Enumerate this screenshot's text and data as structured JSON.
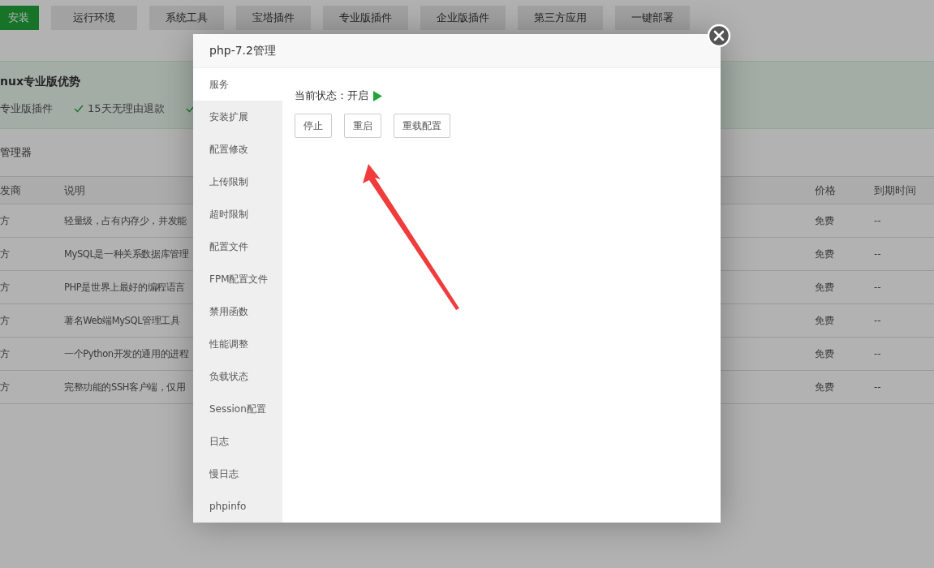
{
  "top_tabs": [
    {
      "label": "安装",
      "selected": true
    },
    {
      "label": "运行环境",
      "selected": false
    },
    {
      "label": "系统工具",
      "selected": false
    },
    {
      "label": "宝塔插件",
      "selected": false
    },
    {
      "label": "专业版插件",
      "selected": false
    },
    {
      "label": "企业版插件",
      "selected": false
    },
    {
      "label": "第三方应用",
      "selected": false
    },
    {
      "label": "一键部署",
      "selected": false
    }
  ],
  "promo": {
    "title": "nux专业版优势",
    "features": [
      {
        "text": "专业版插件",
        "checked": false
      },
      {
        "text": "15天无理由退款",
        "checked": true
      }
    ]
  },
  "section_title": "管理器",
  "table": {
    "columns": [
      "发商",
      "说明",
      "价格",
      "到期时间"
    ],
    "rows": [
      {
        "vendor": "方",
        "description": "轻量级，占有内存少，并发能",
        "price": "免费",
        "expiry": "--"
      },
      {
        "vendor": "方",
        "description": "MySQL是一种关系数据库管理",
        "price": "免费",
        "expiry": "--"
      },
      {
        "vendor": "方",
        "description": "PHP是世界上最好的编程语言",
        "price": "免费",
        "expiry": "--"
      },
      {
        "vendor": "方",
        "description": "著名Web端MySQL管理工具",
        "price": "免费",
        "expiry": "--"
      },
      {
        "vendor": "方",
        "description": "一个Python开发的通用的进程",
        "price": "免费",
        "expiry": "--"
      },
      {
        "vendor": "方",
        "description": "完整功能的SSH客户端，仅用",
        "price": "免费",
        "expiry": "--"
      }
    ]
  },
  "dialog": {
    "title": "php-7.2管理",
    "nav": [
      {
        "label": "服务",
        "selected": true
      },
      {
        "label": "安装扩展",
        "selected": false
      },
      {
        "label": "配置修改",
        "selected": false
      },
      {
        "label": "上传限制",
        "selected": false
      },
      {
        "label": "超时限制",
        "selected": false
      },
      {
        "label": "配置文件",
        "selected": false
      },
      {
        "label": "FPM配置文件",
        "selected": false
      },
      {
        "label": "禁用函数",
        "selected": false
      },
      {
        "label": "性能调整",
        "selected": false
      },
      {
        "label": "负载状态",
        "selected": false
      },
      {
        "label": "Session配置",
        "selected": false
      },
      {
        "label": "日志",
        "selected": false
      },
      {
        "label": "慢日志",
        "selected": false
      },
      {
        "label": "phpinfo",
        "selected": false
      }
    ],
    "status_label": "当前状态：",
    "status_value": "开启",
    "running": true,
    "buttons": [
      "停止",
      "重启",
      "重载配置"
    ]
  }
}
